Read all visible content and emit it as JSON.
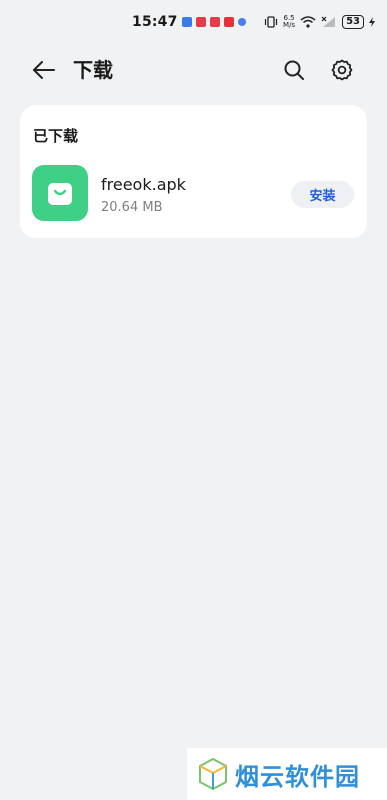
{
  "status_bar": {
    "time": "15:47",
    "net_speed_value": "6.5",
    "net_speed_unit": "M/s",
    "battery": "53"
  },
  "header": {
    "title": "下载"
  },
  "downloaded": {
    "section_title": "已下载",
    "items": [
      {
        "name": "freeok.apk",
        "size": "20.64 MB",
        "action_label": "安装",
        "icon": "shopping-bag-icon",
        "icon_color": "#3fcf85"
      }
    ]
  },
  "watermark": {
    "text": "烟云软件园"
  },
  "colors": {
    "background": "#f1f2f4",
    "accent": "#1f5fe0"
  }
}
